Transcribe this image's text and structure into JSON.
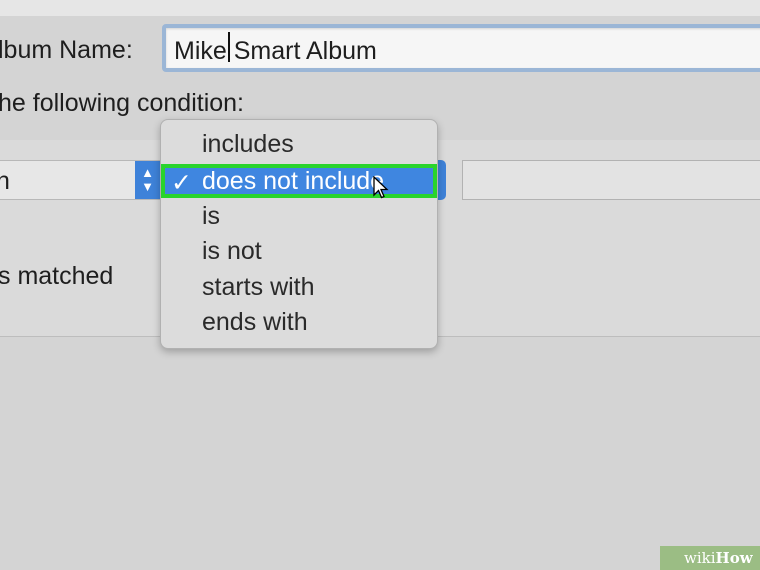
{
  "album_name": {
    "label": "lbum Name:",
    "value": "Mike Smart Album"
  },
  "condition_text": "he following condition:",
  "rule": {
    "field_value": "n",
    "value_field": ""
  },
  "matched_text": "s matched",
  "operator_menu": {
    "items": [
      "includes",
      "does not include",
      "is",
      "is not",
      "starts with",
      "ends with"
    ],
    "selected_index": 1,
    "checkmark": "✓"
  },
  "watermark": {
    "wiki": "wiki",
    "how": "How"
  },
  "colors": {
    "highlight": "#3f86e0",
    "annotation_box": "#29d42c",
    "focus_ring": "#9bb6d6"
  }
}
